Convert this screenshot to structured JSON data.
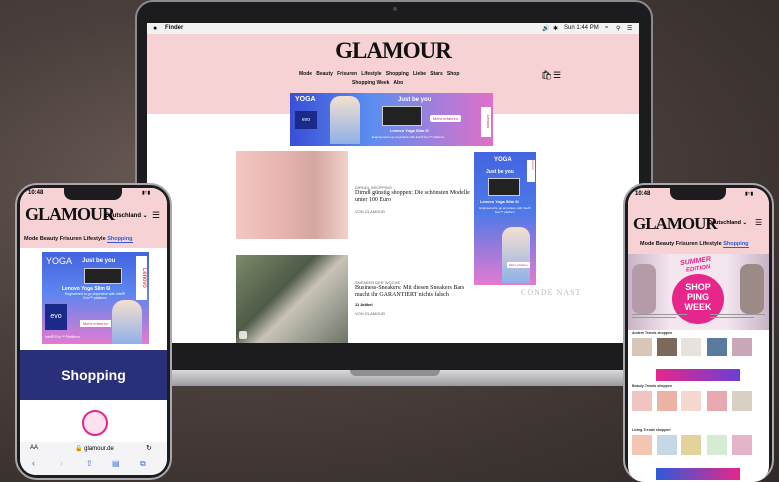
{
  "laptop": {
    "menubar": {
      "apple": "",
      "app": "Finder",
      "time": "Sun 1:44 PM"
    },
    "logo": "GLAMOUR",
    "nav_row1": [
      "Mode",
      "Beauty",
      "Frisuren",
      "Lifestyle",
      "Shopping",
      "Liebe",
      "Stars",
      "Shop"
    ],
    "nav_row2": [
      "Shopping Week",
      "Abo"
    ],
    "banner_ad": {
      "brand": "YOGA",
      "tagline": "Just be you",
      "cta": "Mehr erfahren",
      "product": "Lenovo Yoga Slim 6i",
      "sub": "Engineered to go anywhere with Intel® Evo™ platform",
      "vendor": "Lenovo",
      "chip": "evo"
    },
    "article1": {
      "category": "DIRNDL SHOPPING",
      "title": "Dirndl günstig shoppen: Die schönsten Modelle unter 100 Euro",
      "byline": "VON GLAMOUR"
    },
    "article2": {
      "category": "SNEAKER DER WOCHE",
      "title": "Business-Sneakers: Mit diesen Sneakers Bars macht ihr GARANTIERT nichts falsch",
      "count": "11 Artikel",
      "byline": "VON GLAMOUR"
    },
    "side_ad": {
      "brand": "YOGA",
      "vendor": "Lenovo",
      "tagline": "Just be you",
      "product": "Lenovo Yoga Slim 6i",
      "sub": "Engineered to go anywhere with Intel® Evo™ platform",
      "cta": "Mehr erfahren"
    },
    "watermark": "CONDÉ NAST"
  },
  "phone_left": {
    "time": "10:48",
    "logo": "GLAMOUR",
    "region": "Deutschland",
    "nav": [
      "Mode",
      "Beauty",
      "Frisuren",
      "Lifestyle",
      "Shopping"
    ],
    "ad": {
      "brand": "YOGA",
      "tagline": "Just be you",
      "product": "Lenovo Yoga Slim 6i",
      "sub": "Engineered to go anywhere with Intel® Evo™ platform",
      "vendor": "Lenovo",
      "chip": "evo",
      "cta": "Mehr erfahren",
      "foot": "Intel® Evo™ Plattform"
    },
    "section": "Shopping",
    "url_aa": "AA",
    "url": "glamour.de"
  },
  "phone_right": {
    "time": "10:48",
    "logo": "GLAMOUR",
    "region": "Deutschland",
    "nav": [
      "Mode",
      "Beauty",
      "Frisuren",
      "Lifestyle",
      "Shopping"
    ],
    "hero": {
      "line1": "SUMMER",
      "line2": "EDITION",
      "shop": "SHOP",
      "ping": "PING",
      "week": "WEEK"
    },
    "sections": [
      "Andere Trends shoppen",
      "Beauty-Trends shoppen",
      "Living-Trends shoppen"
    ]
  },
  "colors": {
    "pink": "#f6d2d4",
    "navy": "#2a2f7a",
    "magenta": "#e6268a",
    "blue": "#2f5bd9"
  }
}
